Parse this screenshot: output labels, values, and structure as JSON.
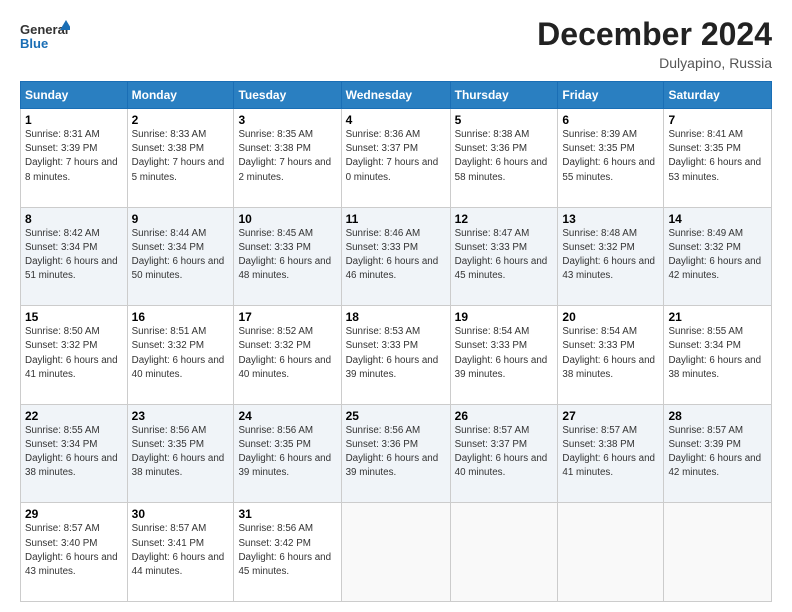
{
  "header": {
    "logo_general": "General",
    "logo_blue": "Blue",
    "month_title": "December 2024",
    "location": "Dulyapino, Russia"
  },
  "days_of_week": [
    "Sunday",
    "Monday",
    "Tuesday",
    "Wednesday",
    "Thursday",
    "Friday",
    "Saturday"
  ],
  "weeks": [
    [
      {
        "day": "1",
        "sunrise": "8:31 AM",
        "sunset": "3:39 PM",
        "daylight": "7 hours and 8 minutes."
      },
      {
        "day": "2",
        "sunrise": "8:33 AM",
        "sunset": "3:38 PM",
        "daylight": "7 hours and 5 minutes."
      },
      {
        "day": "3",
        "sunrise": "8:35 AM",
        "sunset": "3:38 PM",
        "daylight": "7 hours and 2 minutes."
      },
      {
        "day": "4",
        "sunrise": "8:36 AM",
        "sunset": "3:37 PM",
        "daylight": "7 hours and 0 minutes."
      },
      {
        "day": "5",
        "sunrise": "8:38 AM",
        "sunset": "3:36 PM",
        "daylight": "6 hours and 58 minutes."
      },
      {
        "day": "6",
        "sunrise": "8:39 AM",
        "sunset": "3:35 PM",
        "daylight": "6 hours and 55 minutes."
      },
      {
        "day": "7",
        "sunrise": "8:41 AM",
        "sunset": "3:35 PM",
        "daylight": "6 hours and 53 minutes."
      }
    ],
    [
      {
        "day": "8",
        "sunrise": "8:42 AM",
        "sunset": "3:34 PM",
        "daylight": "6 hours and 51 minutes."
      },
      {
        "day": "9",
        "sunrise": "8:44 AM",
        "sunset": "3:34 PM",
        "daylight": "6 hours and 50 minutes."
      },
      {
        "day": "10",
        "sunrise": "8:45 AM",
        "sunset": "3:33 PM",
        "daylight": "6 hours and 48 minutes."
      },
      {
        "day": "11",
        "sunrise": "8:46 AM",
        "sunset": "3:33 PM",
        "daylight": "6 hours and 46 minutes."
      },
      {
        "day": "12",
        "sunrise": "8:47 AM",
        "sunset": "3:33 PM",
        "daylight": "6 hours and 45 minutes."
      },
      {
        "day": "13",
        "sunrise": "8:48 AM",
        "sunset": "3:32 PM",
        "daylight": "6 hours and 43 minutes."
      },
      {
        "day": "14",
        "sunrise": "8:49 AM",
        "sunset": "3:32 PM",
        "daylight": "6 hours and 42 minutes."
      }
    ],
    [
      {
        "day": "15",
        "sunrise": "8:50 AM",
        "sunset": "3:32 PM",
        "daylight": "6 hours and 41 minutes."
      },
      {
        "day": "16",
        "sunrise": "8:51 AM",
        "sunset": "3:32 PM",
        "daylight": "6 hours and 40 minutes."
      },
      {
        "day": "17",
        "sunrise": "8:52 AM",
        "sunset": "3:32 PM",
        "daylight": "6 hours and 40 minutes."
      },
      {
        "day": "18",
        "sunrise": "8:53 AM",
        "sunset": "3:33 PM",
        "daylight": "6 hours and 39 minutes."
      },
      {
        "day": "19",
        "sunrise": "8:54 AM",
        "sunset": "3:33 PM",
        "daylight": "6 hours and 39 minutes."
      },
      {
        "day": "20",
        "sunrise": "8:54 AM",
        "sunset": "3:33 PM",
        "daylight": "6 hours and 38 minutes."
      },
      {
        "day": "21",
        "sunrise": "8:55 AM",
        "sunset": "3:34 PM",
        "daylight": "6 hours and 38 minutes."
      }
    ],
    [
      {
        "day": "22",
        "sunrise": "8:55 AM",
        "sunset": "3:34 PM",
        "daylight": "6 hours and 38 minutes."
      },
      {
        "day": "23",
        "sunrise": "8:56 AM",
        "sunset": "3:35 PM",
        "daylight": "6 hours and 38 minutes."
      },
      {
        "day": "24",
        "sunrise": "8:56 AM",
        "sunset": "3:35 PM",
        "daylight": "6 hours and 39 minutes."
      },
      {
        "day": "25",
        "sunrise": "8:56 AM",
        "sunset": "3:36 PM",
        "daylight": "6 hours and 39 minutes."
      },
      {
        "day": "26",
        "sunrise": "8:57 AM",
        "sunset": "3:37 PM",
        "daylight": "6 hours and 40 minutes."
      },
      {
        "day": "27",
        "sunrise": "8:57 AM",
        "sunset": "3:38 PM",
        "daylight": "6 hours and 41 minutes."
      },
      {
        "day": "28",
        "sunrise": "8:57 AM",
        "sunset": "3:39 PM",
        "daylight": "6 hours and 42 minutes."
      }
    ],
    [
      {
        "day": "29",
        "sunrise": "8:57 AM",
        "sunset": "3:40 PM",
        "daylight": "6 hours and 43 minutes."
      },
      {
        "day": "30",
        "sunrise": "8:57 AM",
        "sunset": "3:41 PM",
        "daylight": "6 hours and 44 minutes."
      },
      {
        "day": "31",
        "sunrise": "8:56 AM",
        "sunset": "3:42 PM",
        "daylight": "6 hours and 45 minutes."
      },
      null,
      null,
      null,
      null
    ]
  ],
  "labels": {
    "sunrise": "Sunrise: ",
    "sunset": "Sunset: ",
    "daylight": "Daylight: "
  }
}
